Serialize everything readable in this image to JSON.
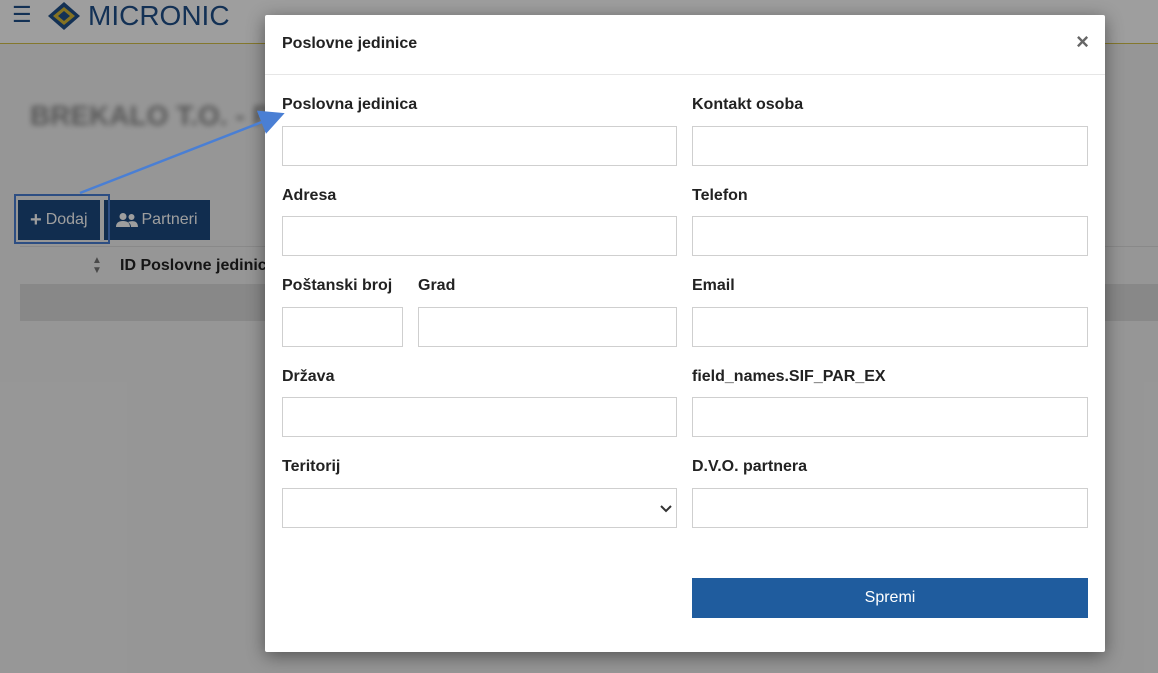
{
  "app": {
    "brand": "MICRONIC",
    "page_title": "BREKALO T.O. - PA",
    "menu_icon": "hamburger-menu-icon"
  },
  "toolbar": {
    "add_label": "Dodaj",
    "partners_label": "Partneri"
  },
  "table": {
    "columns": [
      "ID Poslovne jedinice"
    ]
  },
  "modal": {
    "title": "Poslovne jedinice",
    "close_glyph": "×",
    "fields": {
      "poslovna_jedinica": {
        "label": "Poslovna jedinica",
        "value": ""
      },
      "kontakt_osoba": {
        "label": "Kontakt osoba",
        "value": ""
      },
      "adresa": {
        "label": "Adresa",
        "value": ""
      },
      "telefon": {
        "label": "Telefon",
        "value": ""
      },
      "postanski_broj": {
        "label": "Poštanski broj",
        "value": ""
      },
      "grad": {
        "label": "Grad",
        "value": ""
      },
      "email": {
        "label": "Email",
        "value": ""
      },
      "drzava": {
        "label": "Država",
        "value": ""
      },
      "sif_par_ex": {
        "label": "field_names.SIF_PAR_EX",
        "value": ""
      },
      "teritorij": {
        "label": "Teritorij",
        "value": ""
      },
      "dvo_partnera": {
        "label": "D.V.O. partnera",
        "value": ""
      }
    },
    "save_label": "Spremi"
  },
  "colors": {
    "primary": "#1c4a80",
    "save_button": "#1f5c9e",
    "annotation": "#4a7fd4"
  }
}
